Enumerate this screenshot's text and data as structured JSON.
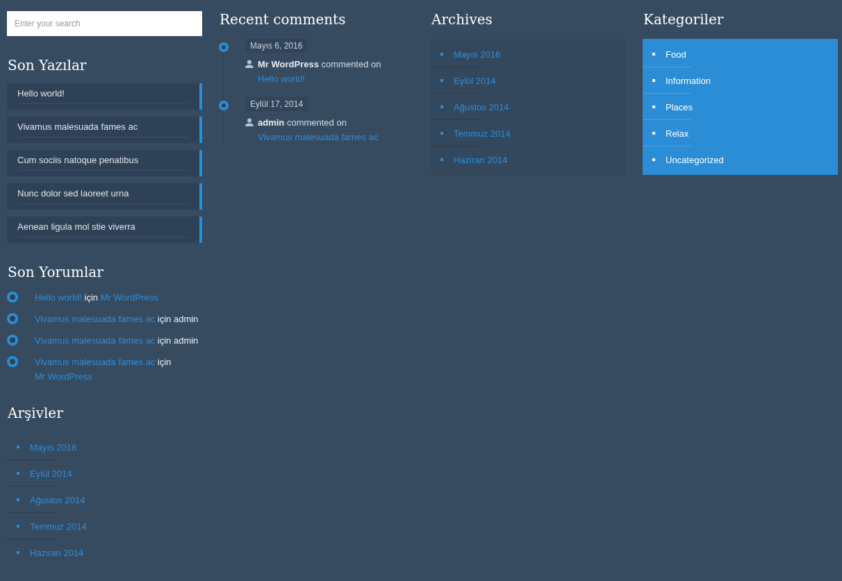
{
  "search": {
    "placeholder": "Enter your search"
  },
  "recent_posts": {
    "title": "Son Yazılar",
    "items": [
      "Hello world!",
      "Vivamus malesuada fames ac",
      "Cum sociis natoque penatibus",
      "Nunc dolor sed laoreet urna",
      "Aenean ligula mol stie viverra"
    ]
  },
  "recent_comments_tr": {
    "title": "Son Yorumlar",
    "items": [
      {
        "parts": [
          {
            "kind": "link",
            "text": "Hello world!"
          },
          {
            "kind": "text",
            "text": "için"
          },
          {
            "kind": "link",
            "text": "Mr WordPress"
          }
        ]
      },
      {
        "parts": [
          {
            "kind": "link",
            "text": "Vivamus malesuada fames ac"
          },
          {
            "kind": "text",
            "text": "için admin"
          }
        ]
      },
      {
        "parts": [
          {
            "kind": "link",
            "text": "Vivamus malesuada fames ac"
          },
          {
            "kind": "text",
            "text": "için admin"
          }
        ]
      },
      {
        "parts": [
          {
            "kind": "link",
            "text": "Vivamus malesuada fames ac"
          },
          {
            "kind": "text",
            "text": "için"
          },
          {
            "kind": "link",
            "text": "Mr WordPress"
          }
        ]
      }
    ]
  },
  "archives_tr": {
    "title": "Arşivler",
    "items": [
      "Mayıs 2016",
      "Eylül 2014",
      "Ağustos 2014",
      "Temmuz 2014",
      "Haziran 2014"
    ]
  },
  "recent_comments": {
    "title": "Recent comments",
    "items": [
      {
        "date": "Mayıs 6, 2016",
        "author": "Mr WordPress",
        "verb": "commented on",
        "post": "Hello world!"
      },
      {
        "date": "Eylül 17, 2014",
        "author": "admin",
        "verb": "commented on",
        "post": "Vivamus malesuada fames ac"
      }
    ]
  },
  "archives": {
    "title": "Archives",
    "items": [
      "Mayıs 2016",
      "Eylül 2014",
      "Ağustos 2014",
      "Temmuz 2014",
      "Haziran 2014"
    ]
  },
  "categories": {
    "title": "Kategoriler",
    "items": [
      "Food",
      "Information",
      "Places",
      "Relax",
      "Uncategorized"
    ]
  }
}
